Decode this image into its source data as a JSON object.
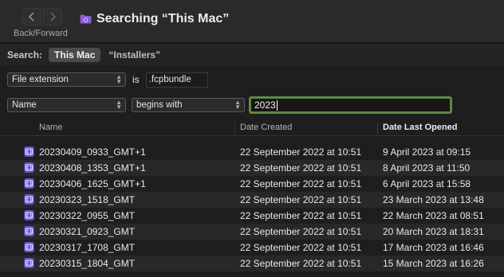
{
  "toolbar": {
    "back_forward_label": "Back/Forward",
    "window_title": "Searching “This Mac”"
  },
  "search": {
    "label": "Search:",
    "scopes": [
      "This Mac",
      "“Installers”"
    ],
    "active_scope": "This Mac"
  },
  "criteria": [
    {
      "attribute": "File extension",
      "operator": "is",
      "value": ".fcpbundle"
    },
    {
      "attribute": "Name",
      "operator": "begins with",
      "value": "2023"
    }
  ],
  "table": {
    "columns": [
      "Name",
      "Date Created",
      "Date Last Opened"
    ],
    "sorted_column": "Date Last Opened",
    "rows": [
      {
        "name": "20230409_0933_GMT+1",
        "created": "22 September 2022 at 10:51",
        "opened": "9 April 2023 at 09:15"
      },
      {
        "name": "20230408_1353_GMT+1",
        "created": "22 September 2022 at 10:51",
        "opened": "8 April 2023 at 11:50"
      },
      {
        "name": "20230406_1625_GMT+1",
        "created": "22 September 2022 at 10:51",
        "opened": "6 April 2023 at 15:58"
      },
      {
        "name": "20230323_1518_GMT",
        "created": "22 September 2022 at 10:51",
        "opened": "23 March 2023 at 13:48"
      },
      {
        "name": "20230322_0955_GMT",
        "created": "22 September 2022 at 10:51",
        "opened": "22 March 2023 at 08:51"
      },
      {
        "name": "20230321_0923_GMT",
        "created": "22 September 2022 at 10:51",
        "opened": "20 March 2023 at 18:31"
      },
      {
        "name": "20230317_1708_GMT",
        "created": "22 September 2022 at 10:51",
        "opened": "17 March 2023 at 16:46"
      },
      {
        "name": "20230315_1804_GMT",
        "created": "22 September 2022 at 10:51",
        "opened": "15 March 2023 at 16:26"
      }
    ]
  },
  "colors": {
    "focus_ring": "#5c8b45",
    "file_icon": "#5d4fd8",
    "folder_icon": "#8a5cd8"
  }
}
